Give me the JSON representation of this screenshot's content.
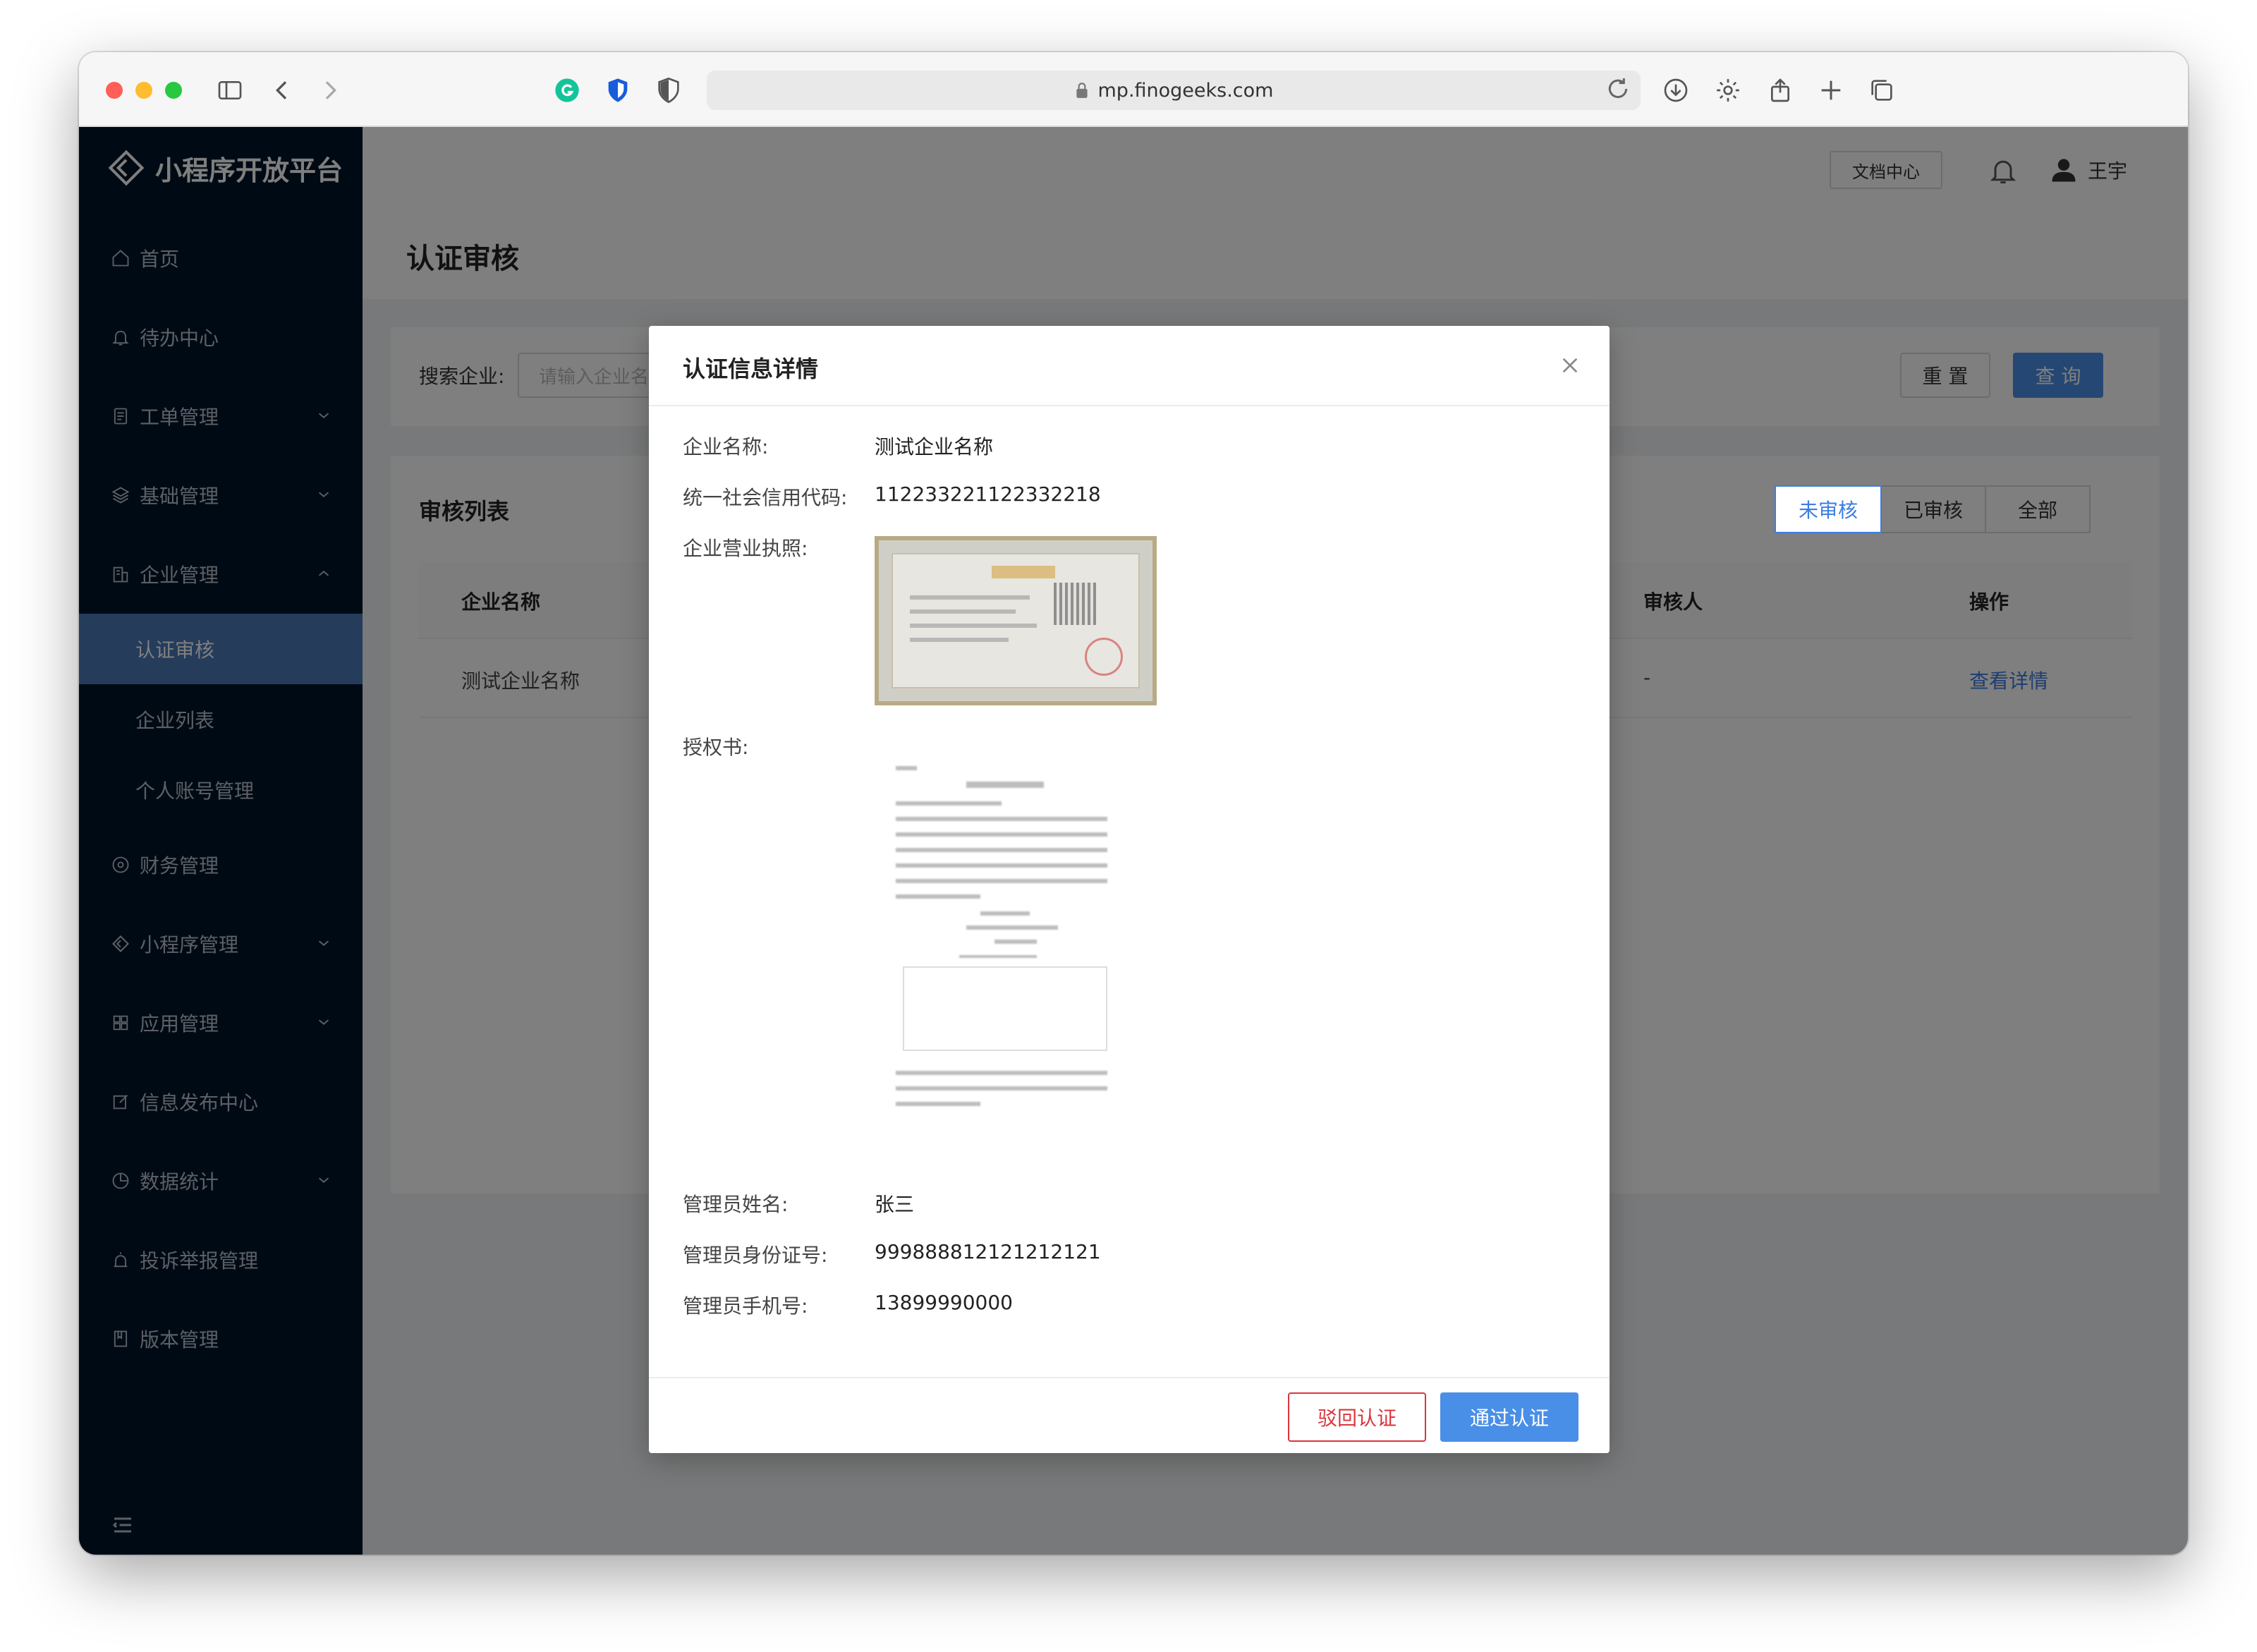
{
  "browser": {
    "url": "mp.finogeeks.com"
  },
  "app": {
    "logo_text": "小程序开放平台",
    "topbar": {
      "doc_center": "文档中心",
      "user_name": "王宇"
    }
  },
  "sidebar": {
    "items": [
      {
        "label": "首页",
        "icon": "home-icon"
      },
      {
        "label": "待办中心",
        "icon": "bell-icon"
      },
      {
        "label": "工单管理",
        "icon": "document-icon",
        "expandable": true
      },
      {
        "label": "基础管理",
        "icon": "layers-icon",
        "expandable": true
      },
      {
        "label": "企业管理",
        "icon": "building-icon",
        "expandable": true,
        "expanded": true
      }
    ],
    "sub_items": [
      {
        "label": "认证审核",
        "active": true
      },
      {
        "label": "企业列表"
      },
      {
        "label": "个人账号管理"
      }
    ],
    "items_after": [
      {
        "label": "财务管理",
        "icon": "coin-icon"
      },
      {
        "label": "小程序管理",
        "icon": "diamond-icon",
        "expandable": true
      },
      {
        "label": "应用管理",
        "icon": "grid-icon",
        "expandable": true
      },
      {
        "label": "信息发布中心",
        "icon": "edit-icon"
      },
      {
        "label": "数据统计",
        "icon": "pie-icon",
        "expandable": true
      },
      {
        "label": "投诉举报管理",
        "icon": "alarm-icon"
      },
      {
        "label": "版本管理",
        "icon": "bookmark-icon"
      }
    ]
  },
  "page": {
    "title": "认证审核",
    "search": {
      "label": "搜索企业:",
      "placeholder": "请输入企业名",
      "reset": "重 置",
      "query": "查 询"
    },
    "list": {
      "title": "审核列表",
      "tabs": [
        "未审核",
        "已审核",
        "全部"
      ],
      "columns": {
        "company": "企业名称",
        "reviewer": "审核人",
        "action": "操作"
      },
      "rows": [
        {
          "company": "测试企业名称",
          "reviewer": "-",
          "action": "查看详情"
        }
      ]
    }
  },
  "modal": {
    "title": "认证信息详情",
    "fields": {
      "company_name_label": "企业名称:",
      "company_name": "测试企业名称",
      "credit_code_label": "统一社会信用代码:",
      "credit_code": "112233221122332218",
      "license_label": "企业营业执照:",
      "authorization_label": "授权书:",
      "admin_name_label": "管理员姓名:",
      "admin_name": "张三",
      "admin_id_label": "管理员身份证号:",
      "admin_id": "999888812121212121",
      "admin_phone_label": "管理员手机号:",
      "admin_phone": "13899990000"
    },
    "reject": "驳回认证",
    "approve": "通过认证"
  },
  "colors": {
    "sidebar_bg": "#001529",
    "sidebar_active": "#4a78b6",
    "primary": "#4a8fe7",
    "danger": "#d9363e"
  }
}
